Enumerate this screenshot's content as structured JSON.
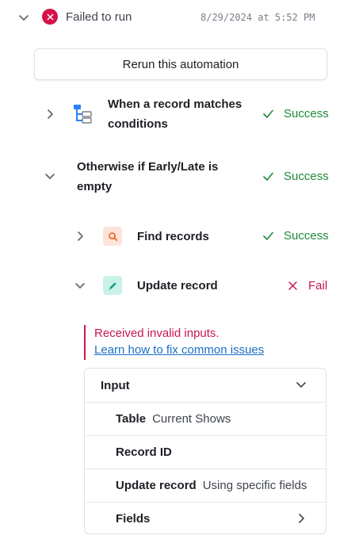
{
  "run": {
    "status_label": "Failed to run",
    "timestamp": "8/29/2024 at 5:52 PM"
  },
  "rerun_button": "Rerun this automation",
  "steps": [
    {
      "title_line1": "When a record matches",
      "title_line2": "conditions",
      "status": "Success"
    },
    {
      "title_line1": "Otherwise if Early/Late is",
      "title_line2": "empty",
      "status": "Success"
    },
    {
      "title": "Find records",
      "status": "Success"
    },
    {
      "title": "Update record",
      "status": "Fail"
    }
  ],
  "error": {
    "message": "Received invalid inputs.",
    "link": "Learn how to fix common issues"
  },
  "input_panel": {
    "header": "Input",
    "rows": [
      {
        "key": "Table",
        "value": "Current Shows"
      },
      {
        "key": "Record ID",
        "value": ""
      },
      {
        "key": "Update record",
        "value": "Using specific fields"
      },
      {
        "key": "Fields",
        "value": ""
      }
    ]
  },
  "colors": {
    "success": "#1f8a3a",
    "fail": "#c8174e",
    "link": "#1b6fc4",
    "trigger_icon": "#2d7ff9",
    "find_icon_bg": "#fde4d8",
    "find_icon": "#e8622c",
    "update_icon_bg": "#c9f2e8",
    "update_icon": "#12a07a"
  },
  "icons": {
    "run_status": "error-circle-icon",
    "trigger": "trigger-branch-icon",
    "find": "search-icon",
    "update": "pencil-icon"
  }
}
